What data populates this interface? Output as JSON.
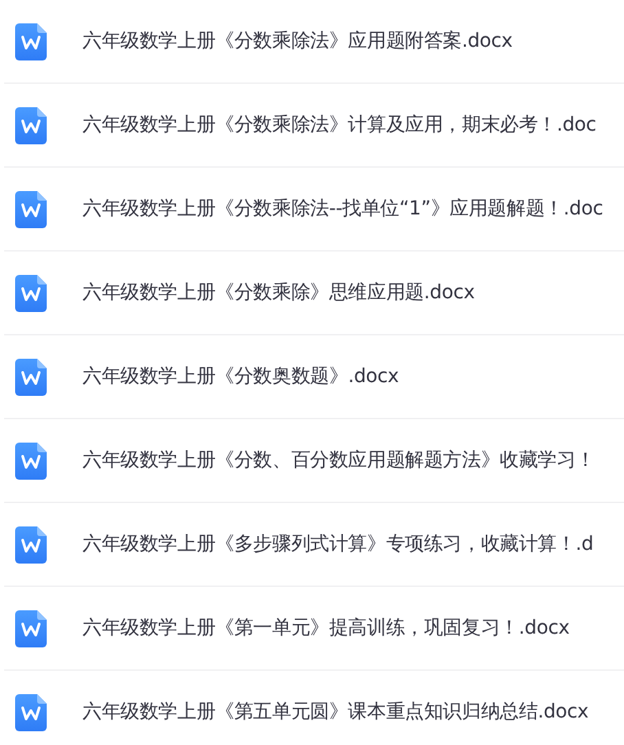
{
  "files": [
    {
      "name": "六年级数学上册《分数乘除法》应用题附答案.docx"
    },
    {
      "name": "六年级数学上册《分数乘除法》计算及应用，期末必考！.doc"
    },
    {
      "name": "六年级数学上册《分数乘除法--找单位“1”》应用题解题！.doc"
    },
    {
      "name": "六年级数学上册《分数乘除》思维应用题.docx"
    },
    {
      "name": "六年级数学上册《分数奥数题》.docx"
    },
    {
      "name": "六年级数学上册《分数、百分数应用题解题方法》收藏学习！"
    },
    {
      "name": "六年级数学上册《多步骤列式计算》专项练习，收藏计算！.d"
    },
    {
      "name": "六年级数学上册《第一单元》提高训练，巩固复习！.docx"
    },
    {
      "name": "六年级数学上册《第五单元圆》课本重点知识归纳总结.docx"
    }
  ]
}
